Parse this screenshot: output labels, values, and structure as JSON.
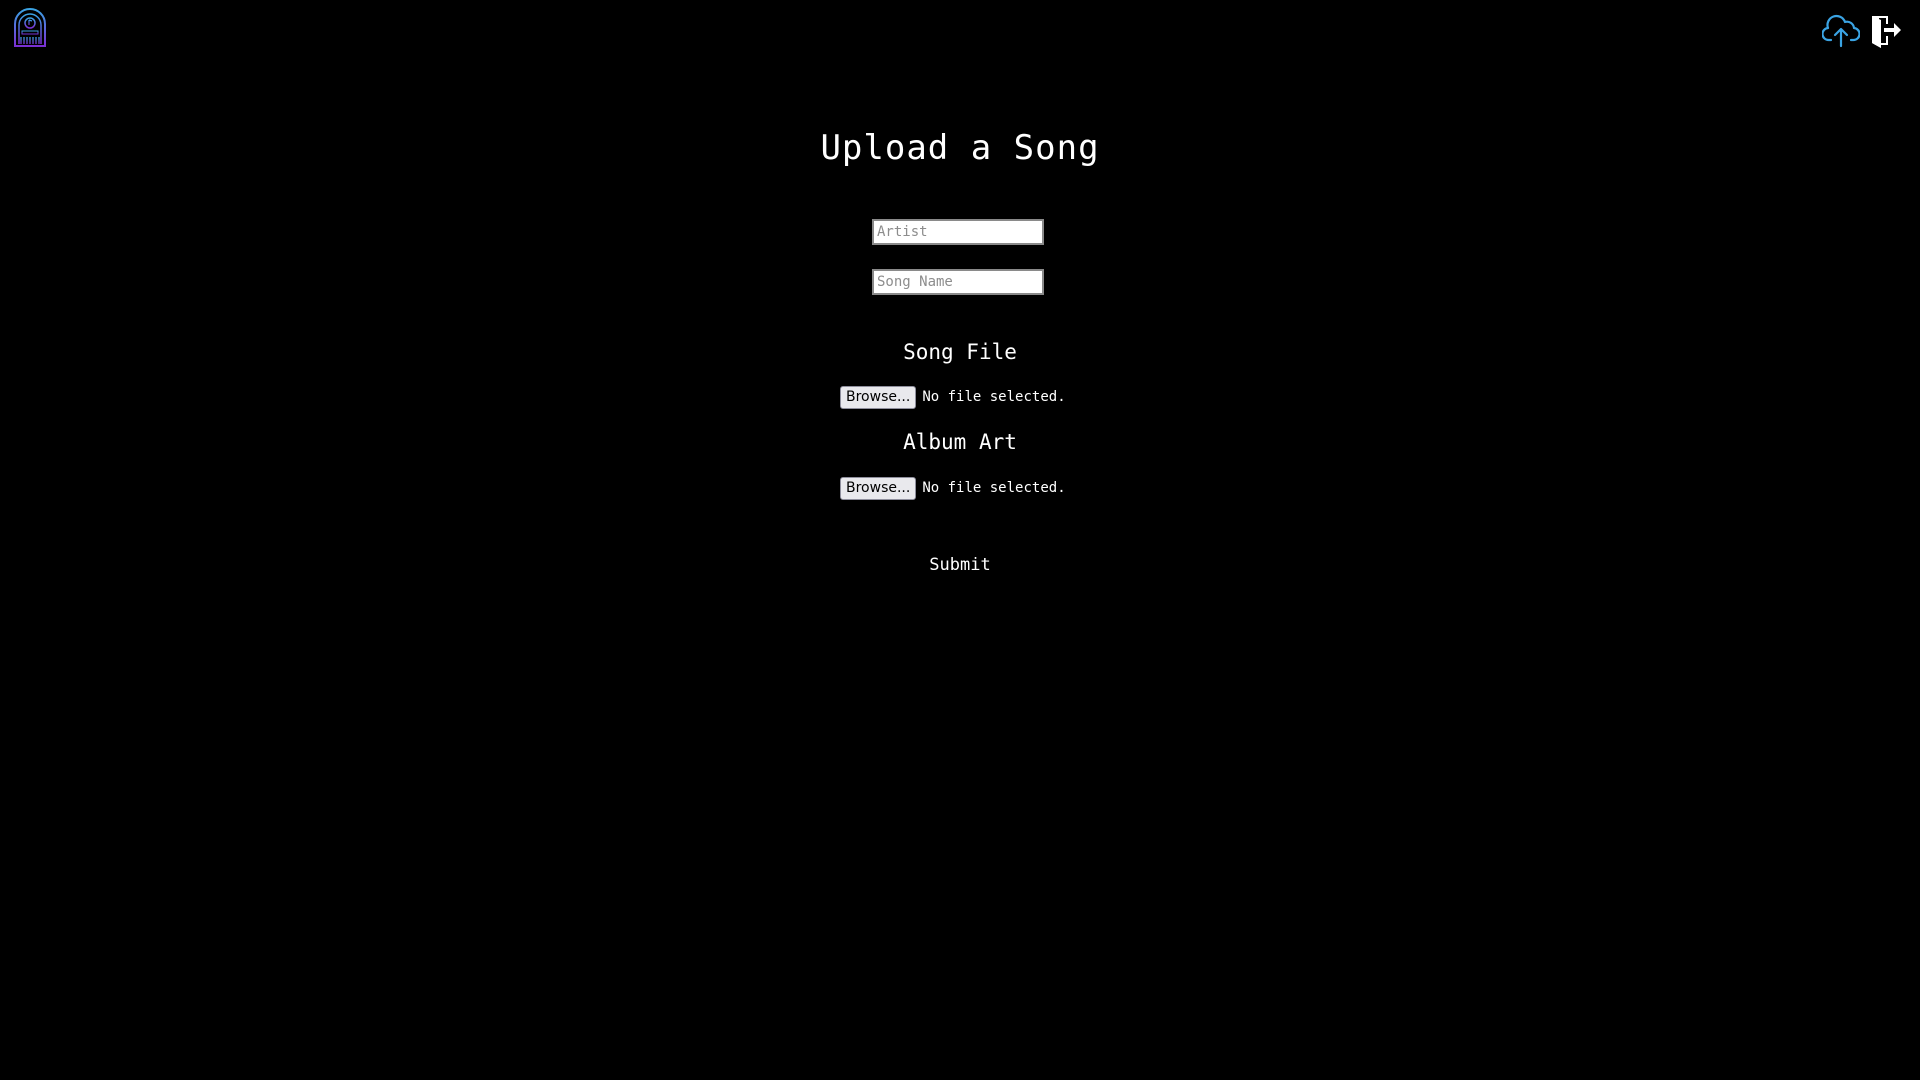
{
  "header": {
    "logo_icon": "jukebox-logo-icon",
    "upload_icon": "cloud-upload-icon",
    "logout_icon": "door-exit-icon",
    "upload_icon_color": "#3aa3e3",
    "logo_colors": [
      "#3aa3e3",
      "#7a2fd4"
    ]
  },
  "form": {
    "title": "Upload a Song",
    "artist_placeholder": "Artist",
    "artist_value": "",
    "song_name_placeholder": "Song Name",
    "song_name_value": "",
    "song_file": {
      "heading": "Song File",
      "browse_label": "Browse...",
      "status": "No file selected."
    },
    "album_art": {
      "heading": "Album Art",
      "browse_label": "Browse...",
      "status": "No file selected."
    },
    "submit_label": "Submit"
  }
}
